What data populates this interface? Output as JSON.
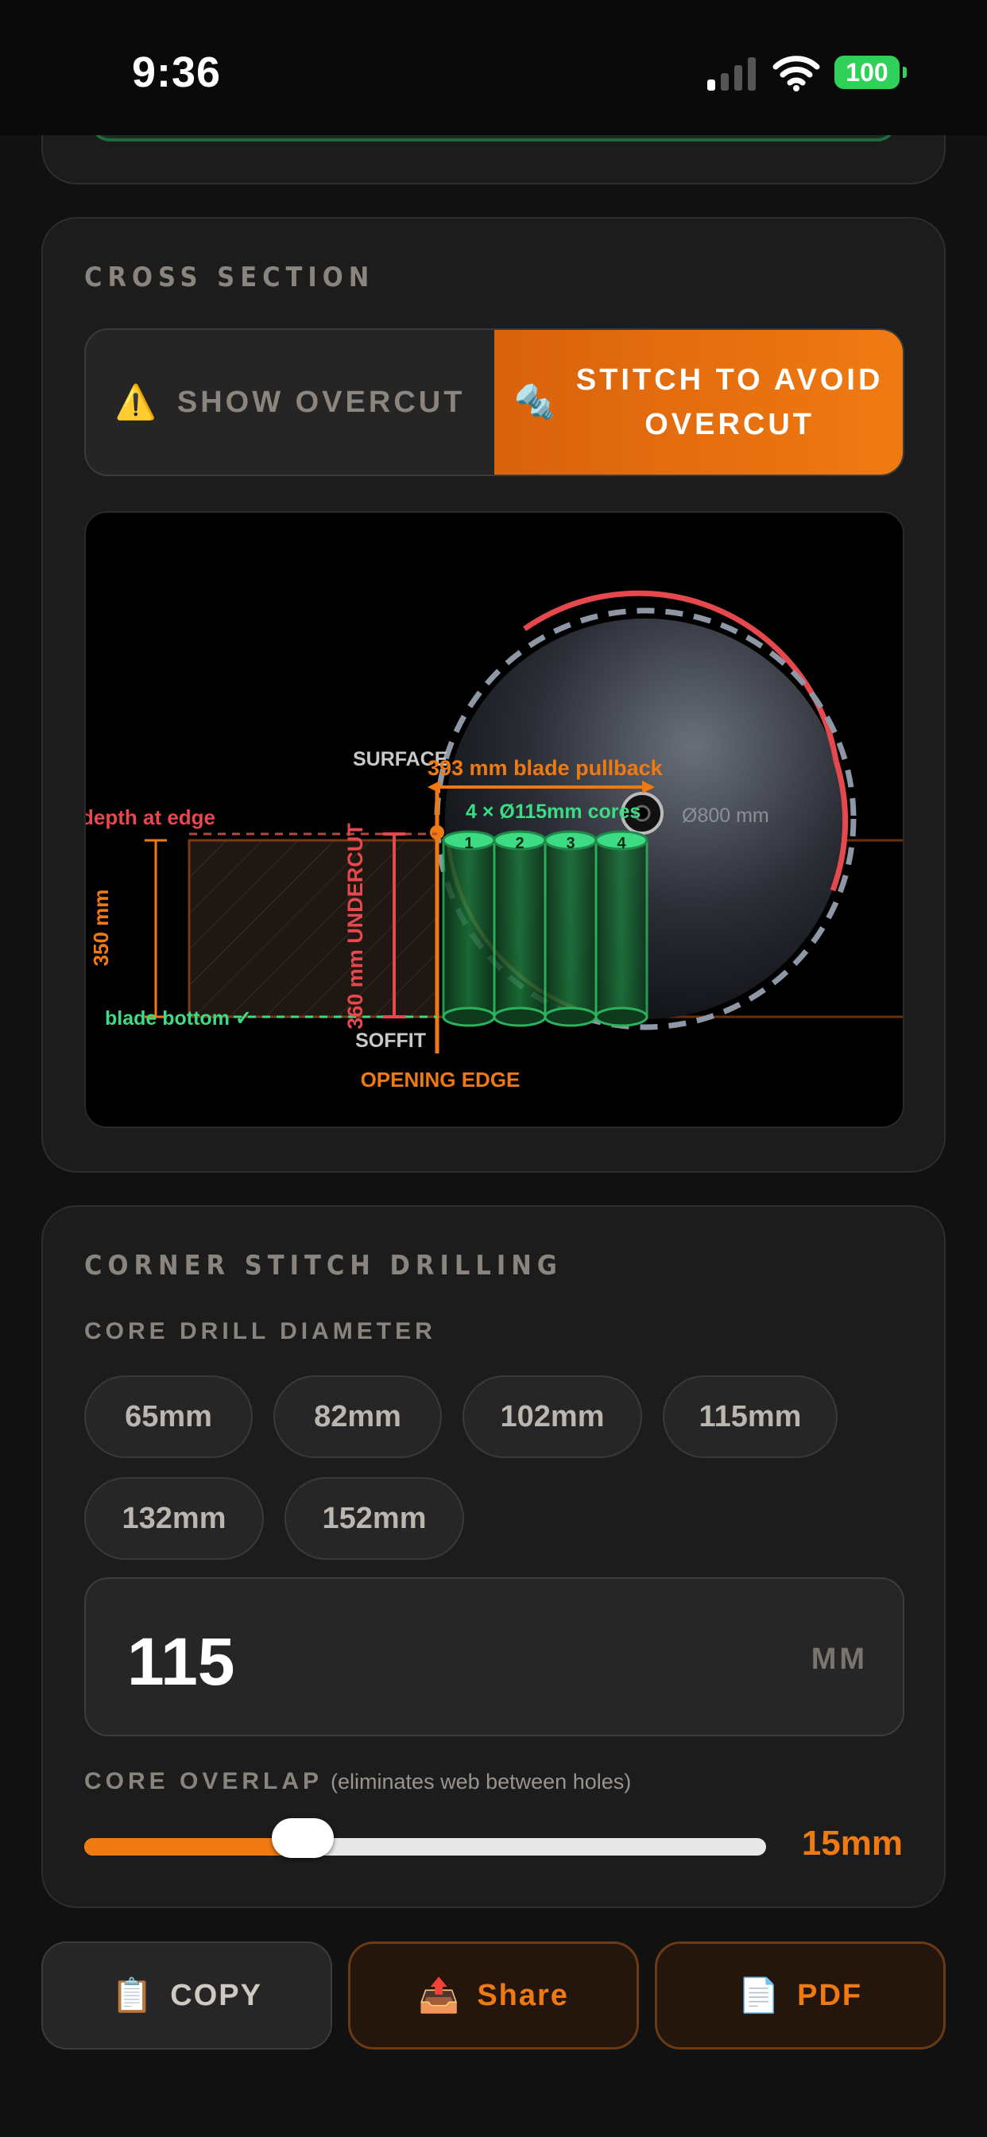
{
  "status_bar": {
    "time": "9:36",
    "battery": "100"
  },
  "cross_section": {
    "title": "CROSS SECTION",
    "toggle": {
      "show_overcut_icon": "⚠️",
      "show_overcut": "SHOW OVERCUT",
      "stitch_icon": "🔩",
      "stitch_line1": "STITCH TO AVOID",
      "stitch_line2": "OVERCUT",
      "selected": "stitch"
    },
    "diagram": {
      "surface": "SURFACE",
      "soffit": "SOFFIT",
      "opening_edge": "OPENING EDGE",
      "pullback": "393 mm blade pullback",
      "cores": "4 × Ø115mm cores",
      "blade_diameter": "Ø800 mm",
      "depth_at_edge": "depth at edge",
      "thickness": "350 mm",
      "undercut": "360 mm UNDERCUT",
      "blade_bottom": "blade bottom ✓",
      "core_numbers": [
        "1",
        "2",
        "3",
        "4"
      ],
      "colors": {
        "orange": "#f07a12",
        "red": "#e5484d",
        "green": "#3ddc84",
        "grey_dash": "#8e97a6"
      }
    }
  },
  "corner_stitch": {
    "title": "CORNER STITCH DRILLING",
    "diameter_label": "CORE DRILL DIAMETER",
    "chips": [
      "65mm",
      "82mm",
      "102mm",
      "115mm",
      "132mm",
      "152mm"
    ],
    "diameter_value": "115",
    "diameter_unit": "MM",
    "overlap_label": "CORE OVERLAP",
    "overlap_note": "(eliminates web between holes)",
    "overlap_value": "15mm",
    "overlap_fraction": 0.32
  },
  "actions": {
    "copy_icon": "📋",
    "copy": "COPY",
    "share_icon": "📤",
    "share": "Share",
    "pdf_icon": "📄",
    "pdf": "PDF"
  }
}
